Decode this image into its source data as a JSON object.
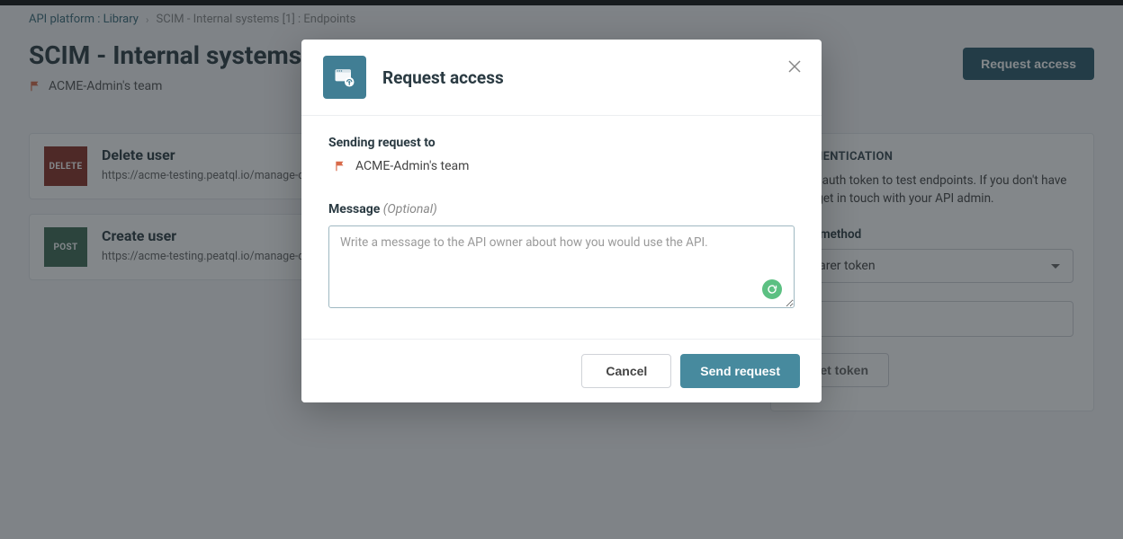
{
  "breadcrumb": {
    "item1": "API platform : Library",
    "item2": "SCIM - Internal systems [1] : Endpoints"
  },
  "page": {
    "title": "SCIM - Internal systems",
    "badge": "1",
    "team": "ACME-Admin's team",
    "request_access_btn": "Request access"
  },
  "endpoints": [
    {
      "method": "DELETE",
      "title": "Delete user",
      "url": "https://acme-testing.peatql.io/manage-custom"
    },
    {
      "method": "POST",
      "title": "Create user",
      "url": "https://acme-testing.peatql.io/manage-custom"
    }
  ],
  "auth_panel": {
    "title": "AUTHENTICATION",
    "description": "Enter auth token to test endpoints. If you don't have one, get in touch with your API admin.",
    "method_label": "Auth method",
    "method_value": "Bearer token",
    "token_placeholder": "",
    "set_token_btn": "Set token"
  },
  "modal": {
    "title": "Request access",
    "sending_label": "Sending request to",
    "team": "ACME-Admin's team",
    "message_label": "Message",
    "message_optional": "(Optional)",
    "message_placeholder": "Write a message to the API owner about how you would use the API.",
    "cancel_btn": "Cancel",
    "send_btn": "Send request"
  }
}
